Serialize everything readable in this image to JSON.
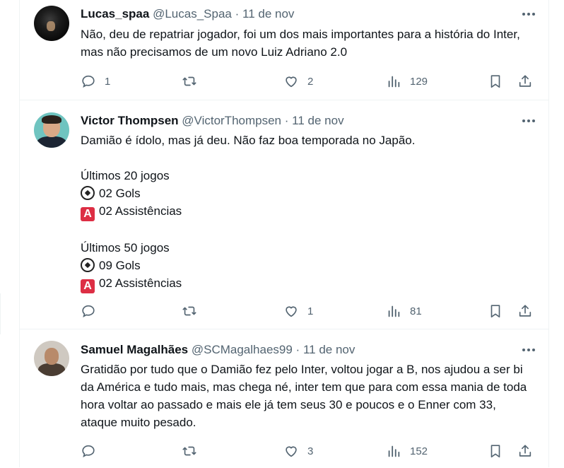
{
  "tweets": [
    {
      "name": "Lucas_spaa",
      "handle": "@Lucas_Spaa",
      "date": "11 de nov",
      "text": [
        "Não, deu de repatriar jogador, foi um dos mais importantes para a história do Inter, mas não precisamos de um novo Luiz Adriano 2.0"
      ],
      "replies": "1",
      "retweets": "",
      "likes": "2",
      "views": "129"
    },
    {
      "name": "Victor Thompsen",
      "handle": "@VictorThompsen",
      "date": "11 de nov",
      "text_main": "Damião é ídolo, mas já deu. Não faz boa temporada no Japão.",
      "block1_title": "Últimos 20 jogos",
      "block1_goals": "02 Gols",
      "block1_assists": "02 Assistências",
      "block2_title": "Últimos 50 jogos",
      "block2_goals": "09 Gols",
      "block2_assists": "02 Assistências",
      "emoji_a": "A",
      "replies": "",
      "retweets": "",
      "likes": "1",
      "views": "81"
    },
    {
      "name": "Samuel Magalhães",
      "handle": "@SCMagalhaes99",
      "date": "11 de nov",
      "text": [
        "Gratidão por tudo que o Damião fez pelo Inter, voltou jogar a B, nos ajudou a ser bi da América e tudo mais, mas chega né, inter tem que para com essa mania de toda hora voltar ao passado e mais ele já tem seus 30 e poucos e o Enner com 33, ataque muito pesado."
      ],
      "replies": "",
      "retweets": "",
      "likes": "3",
      "views": "152"
    }
  ],
  "separator": "·",
  "icons": {
    "reply": "reply-icon",
    "retweet": "retweet-icon",
    "like": "heart-icon",
    "views": "views-icon",
    "bookmark": "bookmark-icon",
    "share": "share-icon",
    "more": "more-icon"
  },
  "colors": {
    "text": "#0f1419",
    "secondary": "#536471",
    "border": "#eff3f4",
    "emoji_red": "#dd2e44"
  }
}
